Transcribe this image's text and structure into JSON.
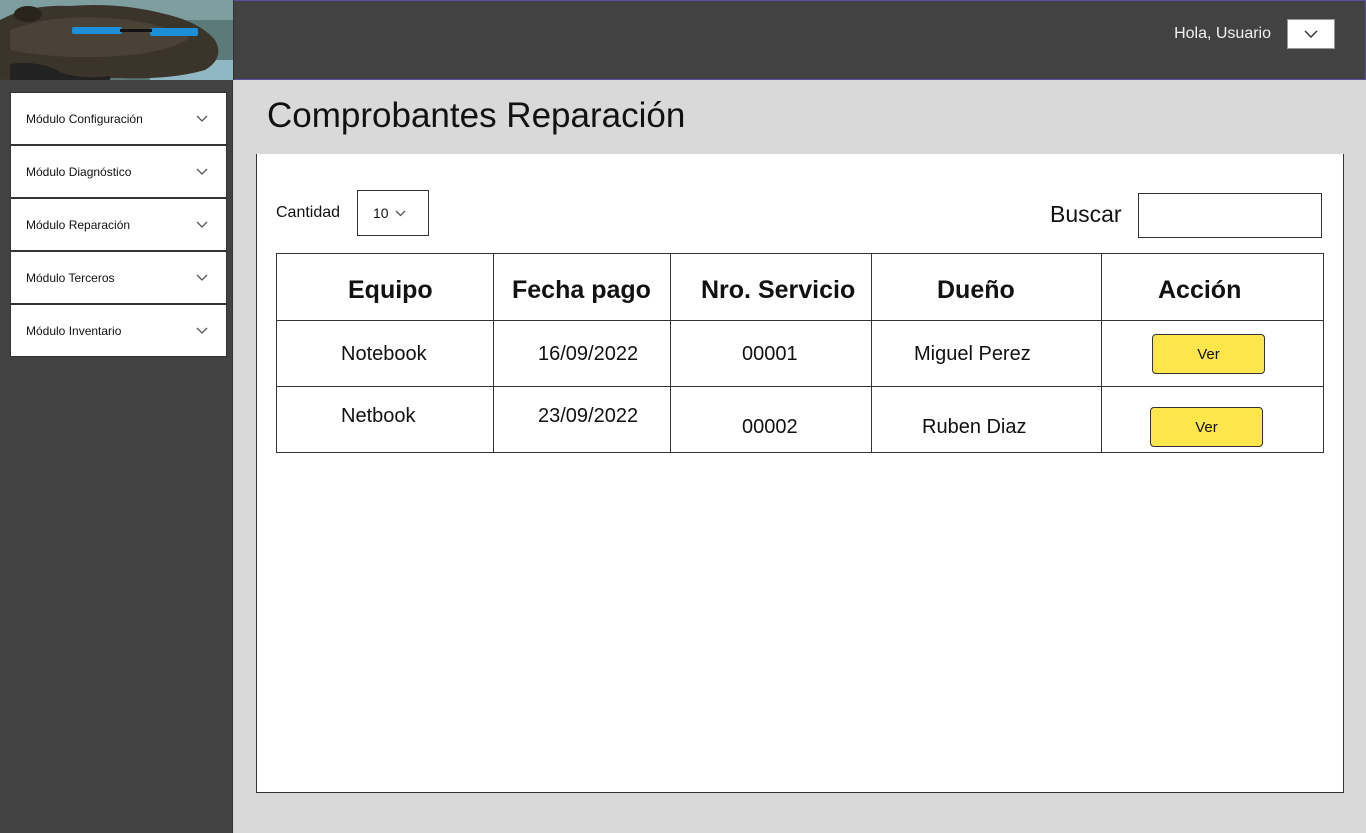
{
  "header": {
    "greeting": "Hola, Usuario",
    "user_menu_icon": "chevron-down-icon"
  },
  "sidebar": {
    "items": [
      {
        "label": "Módulo Configuración",
        "icon": "chevron-down-icon"
      },
      {
        "label": "Módulo Diagnóstico",
        "icon": "chevron-down-icon"
      },
      {
        "label": "Módulo Reparación",
        "icon": "chevron-down-icon"
      },
      {
        "label": "Módulo Terceros",
        "icon": "chevron-down-icon"
      },
      {
        "label": "Módulo Inventario",
        "icon": "chevron-down-icon"
      }
    ]
  },
  "main": {
    "title": "Comprobantes Reparación",
    "quantity_label": "Cantidad",
    "quantity_value": "10",
    "search_label": "Buscar",
    "search_value": ""
  },
  "table": {
    "columns": [
      "Equipo",
      "Fecha pago",
      "Nro. Servicio",
      "Dueño",
      "Acción"
    ],
    "rows": [
      {
        "equipo": "Notebook",
        "fecha": "16/09/2022",
        "servicio": "00001",
        "dueno": "Miguel Perez",
        "accion": "Ver"
      },
      {
        "equipo": "Netbook",
        "fecha": "23/09/2022",
        "servicio": "00002",
        "dueno": "Ruben Diaz",
        "accion": "Ver"
      }
    ]
  },
  "colors": {
    "topbar": "#424242",
    "sidebar": "#424242",
    "background": "#d9d9d9",
    "button_yellow": "#fde64b"
  }
}
